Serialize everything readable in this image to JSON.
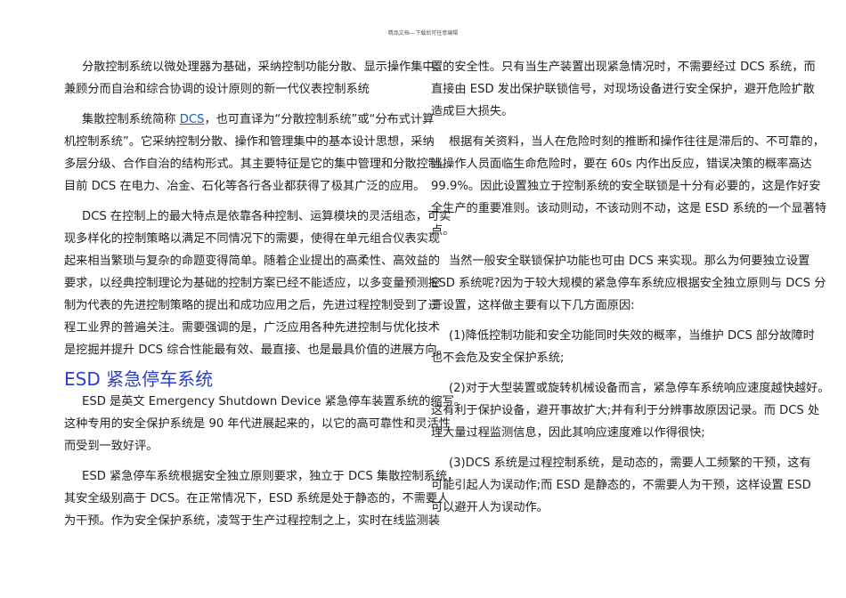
{
  "header": "精品文档---下载后可任意编辑",
  "left": {
    "p1": [
      "分散控制系统以微处理器为基础，采纳控制功能分散、显示操作集中、",
      "兼顾分而自治和综合协调的设计原则的新一代仪表控制系统"
    ],
    "p2_first": {
      "before": "集散控制系统简称 ",
      "link": "DCS",
      "after": "，也可直译为“分散控制系统”或“分布式计算"
    },
    "p2": [
      "机控制系统”。它采纳控制分散、操作和管理集中的基本设计思想，采纳",
      "多层分级、合作自治的结构形式。其主要特征是它的集中管理和分散控制。",
      "目前 DCS 在电力、冶金、石化等各行各业都获得了极其广泛的应用。"
    ],
    "p3": [
      "DCS 在控制上的最大特点是依靠各种控制、运算模块的灵活组态，可实",
      "现多样化的控制策略以满足不同情况下的需要，使得在单元组合仪表实现",
      "起来相当繁琐与复杂的命题变得简单。随着企业提出的高柔性、高效益的",
      "要求，以经典控制理论为基础的控制方案已经不能适应，以多变量预测控",
      "制为代表的先进控制策略的提出和成功应用之后，先进过程控制受到了过",
      "程工业界的普遍关注。需要强调的是，广泛应用各种先进控制与优化技术",
      "是挖掘并提升 DCS 综合性能最有效、最直接、也是最具价值的进展方向。"
    ],
    "heading": "ESD 紧急停车系统",
    "p4": [
      "ESD 是英文 Emergency Shutdown Device 紧急停车装置系统的缩写。",
      "这种专用的安全保护系统是 90 年代进展起来的，以它的高可靠性和灵活性",
      "而受到一致好评。"
    ],
    "p5": [
      "ESD 紧急停车系统根据安全独立原则要求，独立于 DCS 集散控制系统，",
      "其安全级别高于 DCS。在正常情况下，ESD 系统是处于静态的，不需要人",
      "为干预。作为安全保护系统，凌驾于生产过程控制之上，实时在线监测装"
    ]
  },
  "right": {
    "p1": [
      "置的安全性。只有当生产装置出现紧急情况时，不需要经过 DCS 系统，而",
      "直接由 ESD 发出保护联锁信号，对现场设备进行安全保护，避开危险扩散",
      "造成巨大损失。"
    ],
    "p2": [
      "根据有关资料，当人在危险时刻的推断和操作往往是滞后的、不可靠的，",
      "当操作人员面临生命危险时，要在 60s 内作出反应，错误决策的概率高达",
      "99.9%。因此设置独立于控制系统的安全联锁是十分有必要的，这是作好安",
      "全生产的重要准则。该动则动，不该动则不动，这是 ESD 系统的一个显著特",
      "点。"
    ],
    "p3": [
      "当然一般安全联锁保护功能也可由 DCS 来实现。那么为何要独立设置",
      "ESD 系统呢?因为于较大规模的紧急停车系统应根据安全独立原则与 DCS 分",
      "开设置，这样做主要有以下几方面原因:"
    ],
    "p4": [
      "(1)降低控制功能和安全功能同时失效的概率，当维护 DCS 部分故障时",
      "也不会危及安全保护系统;"
    ],
    "p5": [
      "(2)对于大型装置或旋转机械设备而言，紧急停车系统响应速度越快越好。",
      "这有利于保护设备，避开事故扩大;并有利于分辨事故原因记录。而 DCS 处",
      "理大量过程监测信息，因此其响应速度难以作得很快;"
    ],
    "p6": [
      "(3)DCS 系统是过程控制系统，是动态的，需要人工频繁的干预，这有",
      "可能引起人为误动作;而 ESD 是静态的，不需要人为干预，这样设置 ESD",
      "可以避开人为误动作。"
    ]
  }
}
